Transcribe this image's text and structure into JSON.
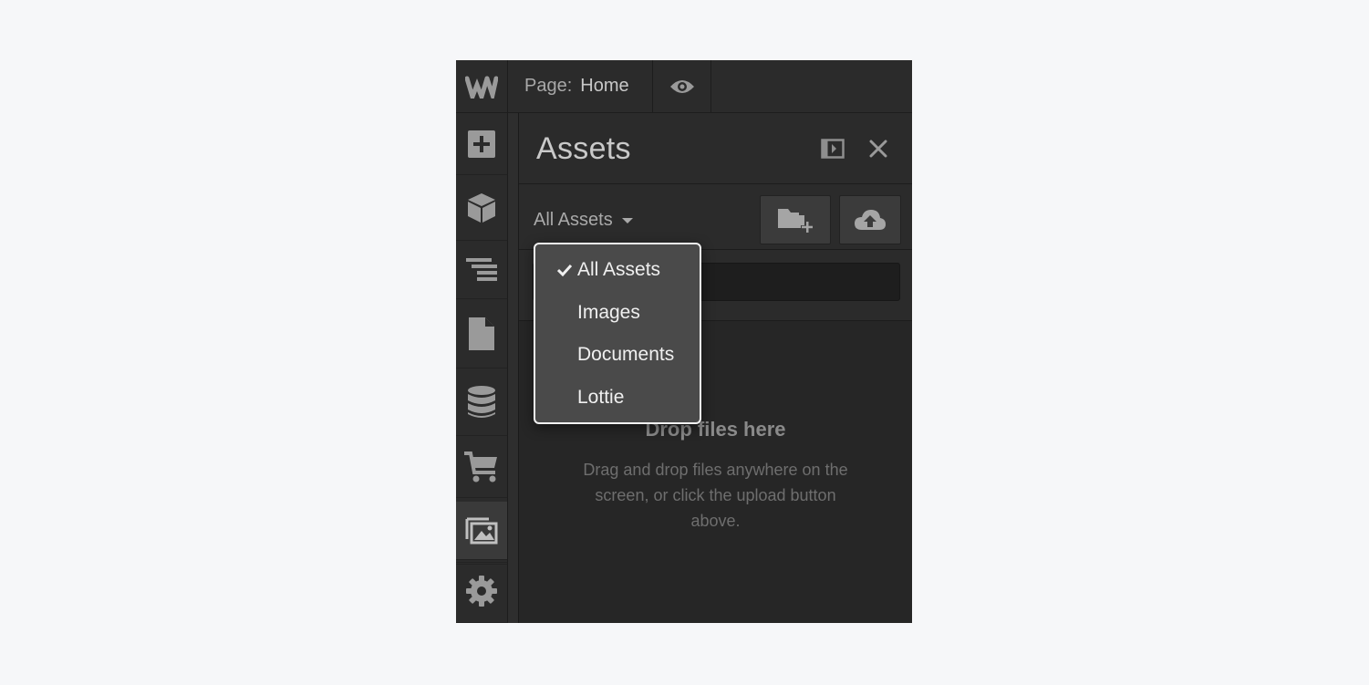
{
  "topbar": {
    "logo_icon": "webflow-logo-icon",
    "page_label": "Page:",
    "page_value": "Home",
    "preview_icon": "eye-icon"
  },
  "sidebar": {
    "items": [
      {
        "name": "add",
        "icon": "plus-square-icon",
        "active": false
      },
      {
        "name": "components",
        "icon": "cube-icon",
        "active": false
      },
      {
        "name": "navigator",
        "icon": "layers-icon",
        "active": false
      },
      {
        "name": "pages",
        "icon": "page-icon",
        "active": false
      },
      {
        "name": "cms",
        "icon": "database-icon",
        "active": false
      },
      {
        "name": "ecommerce",
        "icon": "cart-icon",
        "active": false
      },
      {
        "name": "assets",
        "icon": "images-icon",
        "active": true
      },
      {
        "name": "settings",
        "icon": "gear-icon",
        "active": false
      }
    ]
  },
  "panel": {
    "title": "Assets",
    "filter_label": "All Assets",
    "search_value": "",
    "empty_title": "Drop files here",
    "empty_desc": "Drag and drop files anywhere on the screen, or click the upload button above."
  },
  "dropdown": {
    "options": [
      {
        "label": "All Assets",
        "selected": true
      },
      {
        "label": "Images",
        "selected": false
      },
      {
        "label": "Documents",
        "selected": false
      },
      {
        "label": "Lottie",
        "selected": false
      }
    ]
  },
  "colors": {
    "background": "#f6f7f9",
    "app_bg": "#262626",
    "icon": "#9a9a9a",
    "dropdown_bg": "#4a4a4a",
    "dropdown_border": "#f2f2f2"
  }
}
